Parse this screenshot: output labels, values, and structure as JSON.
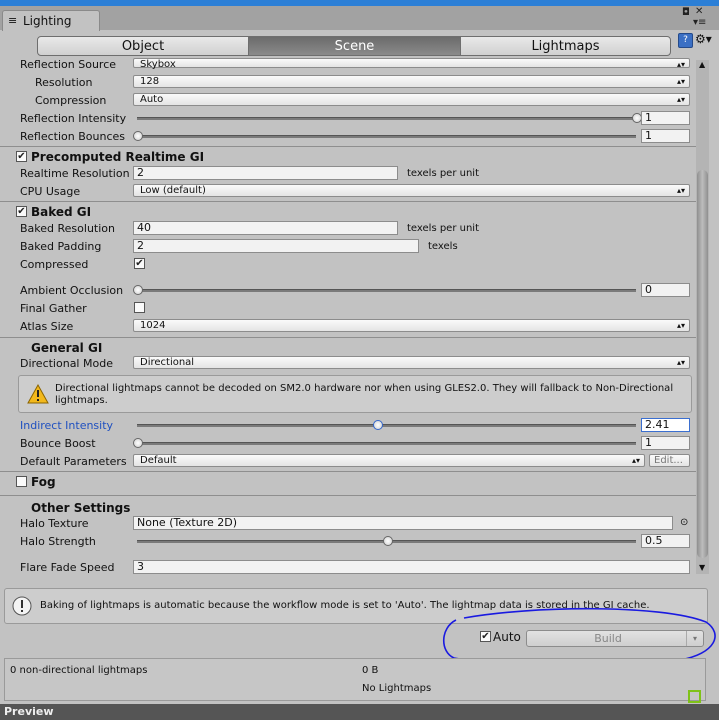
{
  "window": {
    "tab_title": "Lighting",
    "tab_icon": "≡",
    "pin_glyph": "◘",
    "close_glyph": "✕",
    "menu_glyph": "▾≡"
  },
  "tabs": [
    {
      "label": "Object",
      "active": false
    },
    {
      "label": "Scene",
      "active": true
    },
    {
      "label": "Lightmaps",
      "active": false
    }
  ],
  "reflection": {
    "source_label": "Reflection Source",
    "source_value": "Skybox",
    "resolution_label": "Resolution",
    "resolution_value": "128",
    "compression_label": "Compression",
    "compression_value": "Auto",
    "intensity_label": "Reflection Intensity",
    "intensity_value": "1",
    "intensity_fraction": 1.0,
    "bounces_label": "Reflection Bounces",
    "bounces_value": "1",
    "bounces_fraction": 0.0
  },
  "realtime_gi": {
    "title": "Precomputed Realtime GI",
    "enabled": true,
    "resolution_label": "Realtime Resolution",
    "resolution_value": "2",
    "resolution_unit": "texels per unit",
    "cpu_label": "CPU Usage",
    "cpu_value": "Low (default)"
  },
  "baked_gi": {
    "title": "Baked GI",
    "enabled": true,
    "resolution_label": "Baked Resolution",
    "resolution_value": "40",
    "resolution_unit": "texels per unit",
    "padding_label": "Baked Padding",
    "padding_value": "2",
    "padding_unit": "texels",
    "compressed_label": "Compressed",
    "compressed": true,
    "ao_label": "Ambient Occlusion",
    "ao_value": "0",
    "ao_fraction": 0.0,
    "final_gather_label": "Final Gather",
    "final_gather": false,
    "atlas_label": "Atlas Size",
    "atlas_value": "1024"
  },
  "general_gi": {
    "title": "General GI",
    "dir_mode_label": "Directional Mode",
    "dir_mode_value": "Directional",
    "warning": "Directional lightmaps cannot be decoded on SM2.0 hardware nor when using GLES2.0. They will fallback to Non-Directional lightmaps.",
    "indirect_label": "Indirect Intensity",
    "indirect_value": "2.41",
    "indirect_fraction": 0.48,
    "bounce_label": "Bounce Boost",
    "bounce_value": "1",
    "bounce_fraction": 0.0,
    "default_params_label": "Default Parameters",
    "default_params_value": "Default",
    "edit_label": "Edit..."
  },
  "fog": {
    "title": "Fog",
    "enabled": false
  },
  "other": {
    "title": "Other Settings",
    "halo_texture_label": "Halo Texture",
    "halo_texture_value": "None (Texture 2D)",
    "halo_strength_label": "Halo Strength",
    "halo_strength_value": "0.5",
    "halo_strength_fraction": 0.5,
    "flare_label": "Flare Fade Speed",
    "flare_value": "3"
  },
  "info": {
    "message": "Baking of lightmaps is automatic because the workflow mode is set to 'Auto'. The lightmap data is stored in the GI cache."
  },
  "build": {
    "auto_label": "Auto",
    "auto_checked": true,
    "build_label": "Build"
  },
  "stats": {
    "lightmaps": "0 non-directional lightmaps",
    "size": "0 B",
    "status": "No Lightmaps"
  },
  "preview_label": "Preview",
  "colors": {
    "accent": "#2c7fd6",
    "link_blue": "#1f50c0",
    "annotation": "#1a1ae0",
    "marker": "#7fc218"
  }
}
